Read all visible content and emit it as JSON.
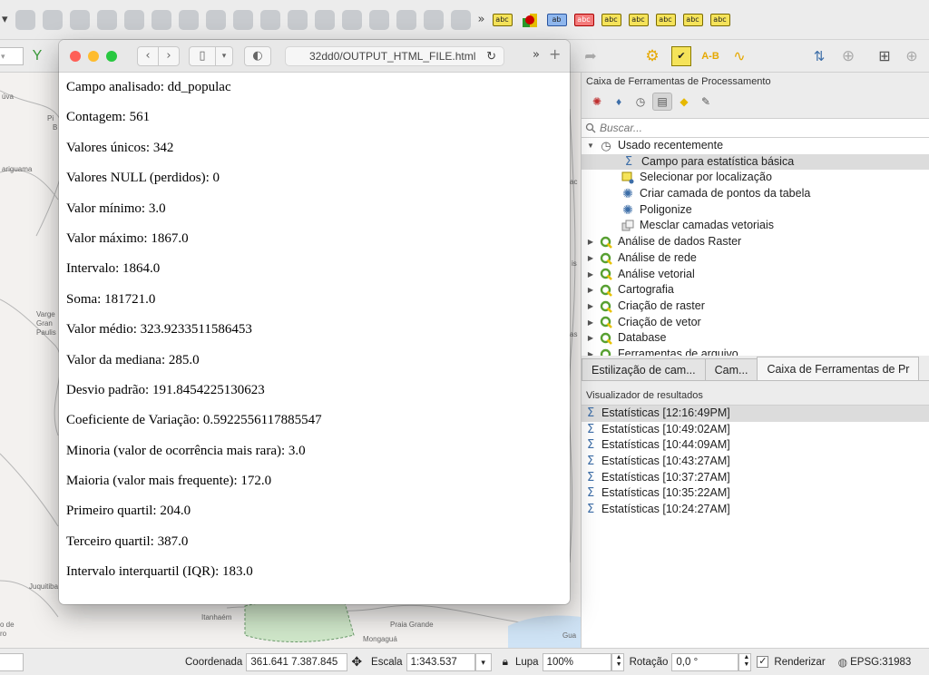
{
  "browser": {
    "url": "32dd0/OUTPUT_HTML_FILE.html",
    "stats": [
      "Campo analisado: dd_populac",
      "Contagem: 561",
      "Valores únicos: 342",
      "Valores NULL (perdidos): 0",
      "Valor mínimo: 3.0",
      "Valor máximo: 1867.0",
      "Intervalo: 1864.0",
      "Soma: 181721.0",
      "Valor médio: 323.9233511586453",
      "Valor da mediana: 285.0",
      "Desvio padrão: 191.8454225130623",
      "Coeficiente de Variação: 0.5922556117885547",
      "Minoria (valor de ocorrência mais rara): 3.0",
      "Maioria (valor mais frequente): 172.0",
      "Primeiro quartil: 204.0",
      "Terceiro quartil: 387.0",
      "Intervalo interquartil (IQR): 183.0"
    ]
  },
  "toolbox": {
    "title": "Caixa de Ferramentas de Processamento",
    "search_placeholder": "Buscar...",
    "recent_group": "Usado recentemente",
    "recent_items": [
      {
        "label": "Campo para estatística básica",
        "icon": "sigma-icon"
      },
      {
        "label": "Selecionar por localização",
        "icon": "select-location-icon"
      },
      {
        "label": "Criar camada de pontos da tabela",
        "icon": "gear-icon"
      },
      {
        "label": "Poligonize",
        "icon": "gear-icon"
      },
      {
        "label": "Mesclar camadas vetoriais",
        "icon": "merge-layers-icon"
      }
    ],
    "providers": [
      "Análise de dados Raster",
      "Análise de rede",
      "Análise vetorial",
      "Cartografia",
      "Criação de raster",
      "Criação de vetor",
      "Database",
      "Ferramentas de arquivo"
    ]
  },
  "tabs": [
    "Estilização de cam...",
    "Cam...",
    "Caixa de Ferramentas de Pr"
  ],
  "results": {
    "title": "Visualizador de resultados",
    "items": [
      "Estatísticas [12:16:49PM]",
      "Estatísticas [10:49:02AM]",
      "Estatísticas [10:44:09AM]",
      "Estatísticas [10:43:27AM]",
      "Estatísticas [10:37:27AM]",
      "Estatísticas [10:35:22AM]",
      "Estatísticas [10:24:27AM]"
    ]
  },
  "map_labels": [
    "úva",
    "Pi",
    "B",
    "ariguama",
    "Varge",
    "Gran",
    "Paulis",
    "Juquitiba",
    "o de",
    "ro",
    "Itanhaém",
    "Praia Grande",
    "Mongaguá",
    "Gua",
    "ac",
    "is",
    "as"
  ],
  "status": {
    "coord_label": "Coordenada",
    "coord_value": "361.641  7.387.845",
    "scale_label": "Escala",
    "scale_value": "1:343.537",
    "lupa_label": "Lupa",
    "lupa_value": "100%",
    "rotation_label": "Rotação",
    "rotation_value": "0,0 °",
    "render_label": "Renderizar",
    "epsg": "EPSG:31983"
  }
}
